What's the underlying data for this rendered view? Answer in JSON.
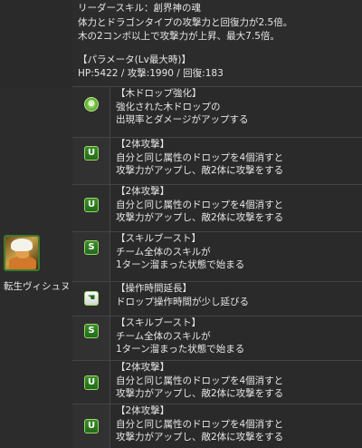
{
  "leader": {
    "line1": "リーダースキル：創界神の魂",
    "line2": "体力とドラゴンタイプの攻撃力と回復力が2.5倍。",
    "line3": "木の2コンボ以上で攻撃力が上昇、最大7.5倍。",
    "params_title": "【パラメータ(Lv最大時)】",
    "params": "HP:5422 / 攻撃:1990 / 回復:183"
  },
  "character": {
    "name": "転生ヴィシュヌ"
  },
  "awakenings": [
    {
      "icon": "wood-drop-enhance-icon",
      "glyph": "⊕",
      "title": "【木ドロップ強化】",
      "lines": [
        "強化された木ドロップの",
        "出現率とダメージがアップする"
      ]
    },
    {
      "icon": "two-way-attack-icon",
      "glyph": "U",
      "title": "【2体攻撃】",
      "lines": [
        "自分と同じ属性のドロップを4個消すと",
        "攻撃力がアップし、敵2体に攻撃をする"
      ]
    },
    {
      "icon": "two-way-attack-icon",
      "glyph": "U",
      "title": "【2体攻撃】",
      "lines": [
        "自分と同じ属性のドロップを4個消すと",
        "攻撃力がアップし、敵2体に攻撃をする"
      ]
    },
    {
      "icon": "skill-boost-icon",
      "glyph": "S",
      "title": "【スキルブースト】",
      "lines": [
        "チーム全体のスキルが",
        "1ターン溜まった状態で始まる"
      ]
    },
    {
      "icon": "time-extend-icon",
      "glyph": "☚",
      "title": "【操作時間延長】",
      "lines": [
        "ドロップ操作時間が少し延びる"
      ]
    },
    {
      "icon": "skill-boost-icon",
      "glyph": "S",
      "title": "【スキルブースト】",
      "lines": [
        "チーム全体のスキルが",
        "1ターン溜まった状態で始まる"
      ]
    },
    {
      "icon": "two-way-attack-icon",
      "glyph": "U",
      "title": "【2体攻撃】",
      "lines": [
        "自分と同じ属性のドロップを4個消すと",
        "攻撃力がアップし、敵2体に攻撃をする"
      ]
    },
    {
      "icon": "two-way-attack-icon",
      "glyph": "U",
      "title": "【2体攻撃】",
      "lines": [
        "自分と同じ属性のドロップを4個消すと",
        "攻撃力がアップし、敵2体に攻撃をする"
      ]
    }
  ]
}
